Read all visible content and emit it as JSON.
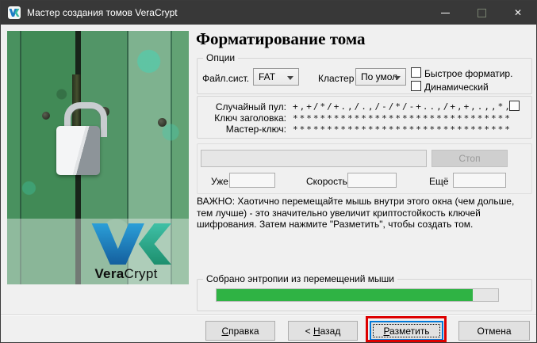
{
  "titlebar": {
    "title": "Мастер создания томов VeraCrypt",
    "close_icon": "✕"
  },
  "page": {
    "heading": "Форматирование тома"
  },
  "options": {
    "legend": "Опции",
    "fs_label": "Файл.сист.",
    "fs_value": "FAT",
    "cluster_label": "Кластер",
    "cluster_value": "По умол",
    "quick_format_label": "Быстрое форматир.",
    "dynamic_label": "Динамический"
  },
  "pool": {
    "random_label": "Случайный пул:",
    "random_value": "+,+/*/+.,/.,/-/*/-+..,/+,+,.,,*,…",
    "header_label": "Ключ заголовка:",
    "header_value": "********************************",
    "master_label": "Мастер-ключ:",
    "master_value": "********************************"
  },
  "progress": {
    "stop_label": "Стоп",
    "done_label": "Уже",
    "done_value": "",
    "speed_label": "Скорость",
    "speed_value": "",
    "left_label": "Ещё",
    "left_value": "",
    "percent": 0
  },
  "notice": "ВАЖНО: Хаотично перемещайте мышь внутри этого окна (чем дольше, тем лучше) - это значительно увеличит криптостойкость ключей шифрования. Затем нажмите \"Разметить\", чтобы создать том.",
  "entropy": {
    "legend": "Собрано энтропии из перемещений мыши",
    "percent": 91
  },
  "footer": {
    "help_mnemonic": "С",
    "help_rest": "правка",
    "back_prefix": "< ",
    "back_mnemonic": "Н",
    "back_rest": "азад",
    "format_mnemonic": "Р",
    "format_rest": "азметить",
    "cancel_label": "Отмена"
  },
  "branding": {
    "logo_bold": "Vera",
    "logo_light": "Crypt"
  },
  "colors": {
    "titlebar": "#383838",
    "accent": "#0078d7",
    "entropy_green": "#2fb344",
    "annotation_red": "#dd0000"
  }
}
